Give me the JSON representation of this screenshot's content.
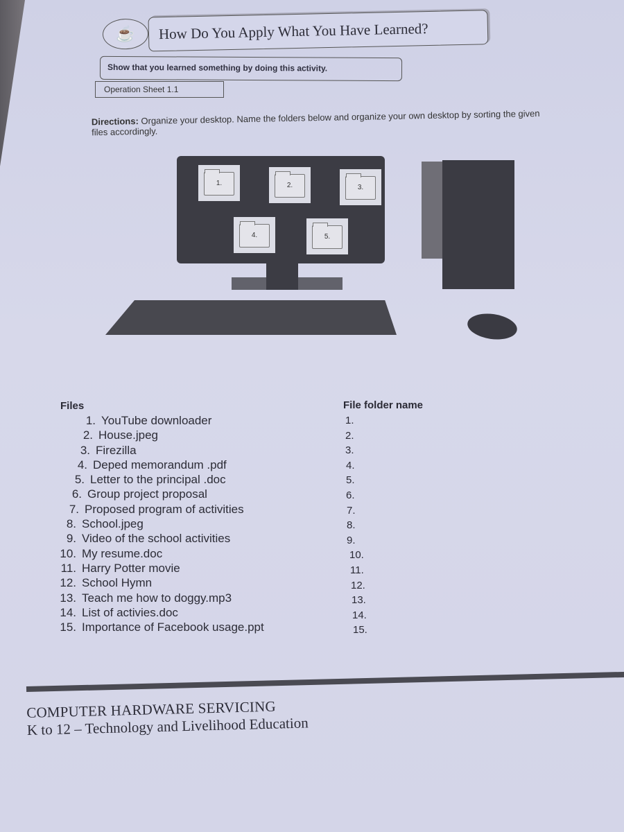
{
  "header": {
    "mascot_icon": "mascot-icon",
    "title": "How Do You Apply What You Have Learned?",
    "subtitle": "Show that you learned something by doing this activity.",
    "operation_sheet": "Operation Sheet 1.1"
  },
  "directions": {
    "label": "Directions:",
    "text": " Organize your desktop. Name the folders below and organize your own desktop by sorting the given files accordingly."
  },
  "illustration": {
    "folders": [
      "1.",
      "2.",
      "3.",
      "4.",
      "5."
    ]
  },
  "files": {
    "heading": "Files",
    "items": [
      {
        "n": "1.",
        "label": "YouTube downloader"
      },
      {
        "n": "2.",
        "label": "House.jpeg"
      },
      {
        "n": "3.",
        "label": "Firezilla"
      },
      {
        "n": "4.",
        "label": "Deped memorandum .pdf"
      },
      {
        "n": "5.",
        "label": "Letter to the principal .doc"
      },
      {
        "n": "6.",
        "label": "Group project proposal"
      },
      {
        "n": "7.",
        "label": "Proposed program of activities"
      },
      {
        "n": "8.",
        "label": "School.jpeg"
      },
      {
        "n": "9.",
        "label": "Video of the school activities"
      },
      {
        "n": "10.",
        "label": "My resume.doc"
      },
      {
        "n": "11.",
        "label": "Harry Potter movie"
      },
      {
        "n": "12.",
        "label": "School Hymn"
      },
      {
        "n": "13.",
        "label": "Teach me how to doggy.mp3"
      },
      {
        "n": "14.",
        "label": "List of activies.doc"
      },
      {
        "n": "15.",
        "label": "Importance of Facebook usage.ppt"
      }
    ]
  },
  "file_folder_names": {
    "heading": "File folder name",
    "items": [
      "1.",
      "2.",
      "3.",
      "4.",
      "5.",
      "6.",
      "7.",
      "8.",
      "9.",
      "10.",
      "11.",
      "12.",
      "13.",
      "14.",
      "15."
    ]
  },
  "footer": {
    "line1": "COMPUTER HARDWARE SERVICING",
    "line2": "K to 12 – Technology and Livelihood Education"
  }
}
